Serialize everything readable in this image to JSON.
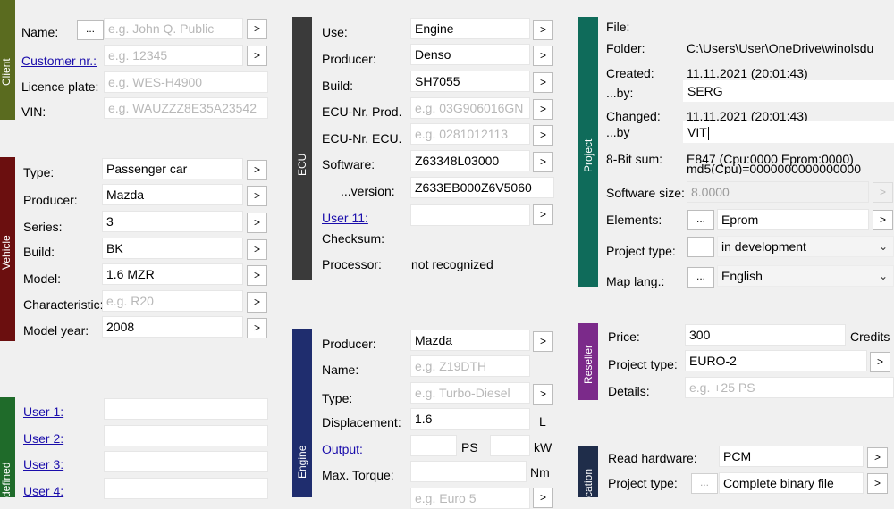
{
  "colors": {
    "client": "#5a6b1f",
    "vehicle": "#6b0f0f",
    "defined": "#1f6b2a",
    "ecu": "#3a3a3a",
    "engine": "#1f2d6e",
    "project": "#0f6b5a",
    "reseller": "#7b2a8a",
    "location": "#1f2d4a"
  },
  "sections": {
    "client": "Client",
    "vehicle": "Vehicle",
    "defined": "defined",
    "ecu": "ECU",
    "engine": "Engine",
    "project": "Project",
    "reseller": "Reseller",
    "location": "cation"
  },
  "client": {
    "name_label": "Name:",
    "name_placeholder": "e.g. John Q. Public",
    "customer_label": "Customer nr.:",
    "customer_placeholder": "e.g. 12345",
    "plate_label": "Licence plate:",
    "plate_placeholder": "e.g. WES-H4900",
    "vin_label": "VIN:",
    "vin_placeholder": "e.g. WAUZZZ8E35A23542"
  },
  "vehicle": {
    "type_label": "Type:",
    "type_value": "Passenger car",
    "producer_label": "Producer:",
    "producer_value": "Mazda",
    "series_label": "Series:",
    "series_value": "3",
    "build_label": "Build:",
    "build_value": "BK",
    "model_label": "Model:",
    "model_value": "1.6 MZR",
    "char_label": "Characteristic:",
    "char_placeholder": "e.g. R20",
    "year_label": "Model year:",
    "year_value": "2008"
  },
  "defined": {
    "user1": "User 1:",
    "user2": "User 2:",
    "user3": "User 3:",
    "user4": "User 4:"
  },
  "ecu": {
    "use_label": "Use:",
    "use_value": "Engine",
    "producer_label": "Producer:",
    "producer_value": "Denso",
    "build_label": "Build:",
    "build_value": "SH7055",
    "prod_label": "ECU-Nr. Prod.",
    "prod_placeholder": "e.g. 03G906016GN",
    "ecu_label": "ECU-Nr. ECU.",
    "ecu_placeholder": "e.g. 0281012113",
    "software_label": "Software:",
    "software_value": "Z63348L03000",
    "version_label": "...version:",
    "version_value": "Z633EB000Z6V5060",
    "user11_label": "User 11:",
    "checksum_label": "Checksum:",
    "processor_label": "Processor:",
    "processor_value": "not recognized"
  },
  "engine": {
    "producer_label": "Producer:",
    "producer_value": "Mazda",
    "name_label": "Name:",
    "name_placeholder": "e.g. Z19DTH",
    "type_label": "Type:",
    "type_placeholder": "e.g. Turbo-Diesel",
    "disp_label": "Displacement:",
    "disp_value": "1.6",
    "disp_unit": "L",
    "output_label": "Output:",
    "ps_unit": "PS",
    "kw_unit": "kW",
    "torque_label": "Max. Torque:",
    "torque_unit": "Nm",
    "euro_placeholder": "e.g. Euro 5"
  },
  "project": {
    "file_label": "File:",
    "folder_label": "Folder:",
    "folder_value": "C:\\Users\\User\\OneDrive\\winolsdu",
    "created_label": "Created:",
    "created_value": "11.11.2021 (20:01:43)",
    "created_by_label": "...by:",
    "created_by_value": "SERG",
    "changed_label": "Changed:",
    "changed_value": "11.11.2021 (20:01:43)",
    "changed_by_label": "...by",
    "changed_by_value": "VIT",
    "checksum_label": "8-Bit sum:",
    "checksum_value": "E847   (Cpu:0000   Eprom:0000)",
    "md5_value": "md5(Cpu)=0000000000000000",
    "swsize_label": "Software size:",
    "swsize_value": "8.0000",
    "elements_label": "Elements:",
    "elements_value": "Eprom",
    "ptype_label": "Project type:",
    "ptype_value": "in development",
    "maplang_label": "Map lang.:",
    "maplang_value": "English"
  },
  "reseller": {
    "price_label": "Price:",
    "price_value": "300",
    "credits_label": "Credits",
    "ptype_label": "Project type:",
    "ptype_value": "EURO-2",
    "details_label": "Details:",
    "details_placeholder": "e.g. +25 PS"
  },
  "location": {
    "hw_label": "Read hardware:",
    "hw_value": "PCM",
    "ptype_label": "Project type:",
    "ptype_value": "Complete binary file"
  },
  "common": {
    "arrow": ">",
    "dots": "...",
    "dropdown_arrow": "⌄"
  }
}
